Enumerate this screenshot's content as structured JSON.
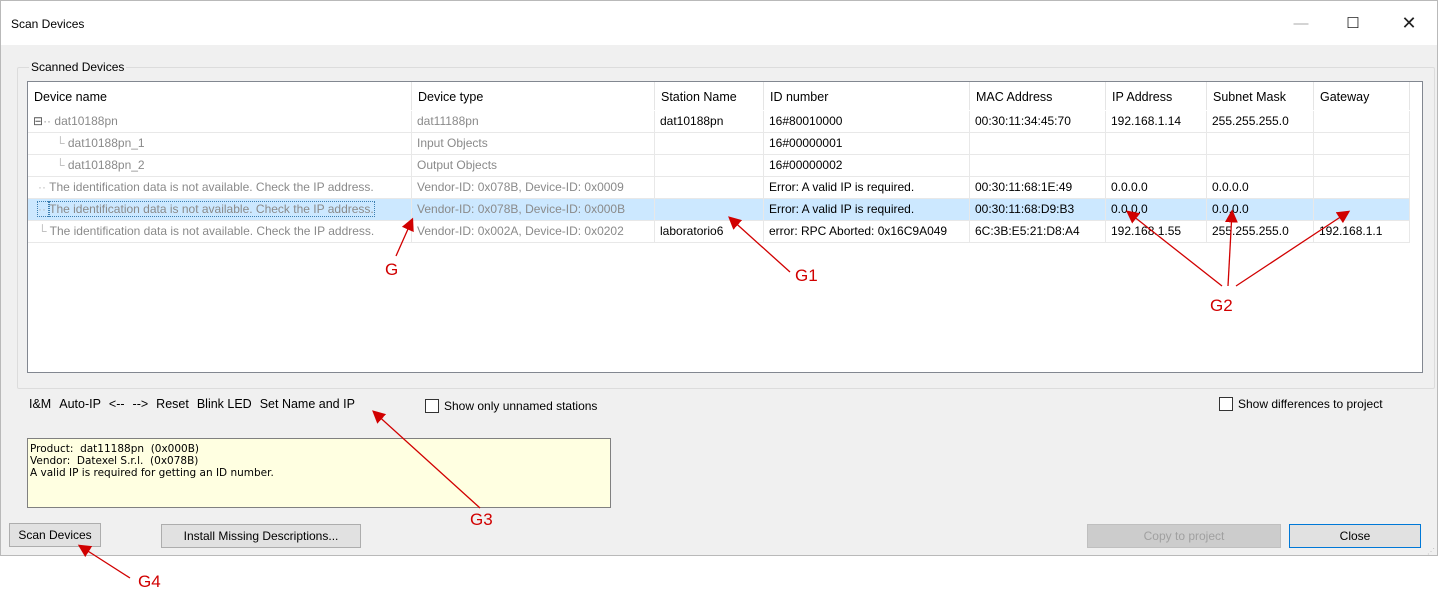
{
  "window": {
    "title": "Scan Devices",
    "min_glyph": "—",
    "max_glyph": "☐",
    "close_glyph": "✕"
  },
  "group": {
    "label": "Scanned Devices"
  },
  "table": {
    "columns": [
      "Device name",
      "Device type",
      "Station Name",
      "ID number",
      "MAC Address",
      "IP Address",
      "Subnet Mask",
      "Gateway"
    ],
    "rows": [
      {
        "name": "dat10188pn",
        "expander": "⊟",
        "type": "dat11188pn",
        "station": "dat10188pn",
        "id": "16#80010000",
        "mac": "00:30:11:34:45:70",
        "ip": "192.168.1.14",
        "mask": "255.255.255.0",
        "gw": ""
      },
      {
        "name": "dat10188pn_1",
        "type": "Input Objects",
        "station": "",
        "id": "16#00000001",
        "mac": "",
        "ip": "",
        "mask": "",
        "gw": ""
      },
      {
        "name": "dat10188pn_2",
        "type": "Output Objects",
        "station": "",
        "id": "16#00000002",
        "mac": "",
        "ip": "",
        "mask": "",
        "gw": ""
      },
      {
        "name": "The identification data is not available. Check the IP address.",
        "type": "Vendor-ID: 0x078B, Device-ID: 0x0009",
        "station": "",
        "id": "Error: A valid IP is required.",
        "mac": "00:30:11:68:1E:49",
        "ip": "0.0.0.0",
        "mask": "0.0.0.0",
        "gw": ""
      },
      {
        "name": "The identification data is not available. Check the IP address.",
        "type": "Vendor-ID: 0x078B, Device-ID: 0x000B",
        "station": "",
        "id": "Error: A valid IP is required.",
        "mac": "00:30:11:68:D9:B3",
        "ip": "0.0.0.0",
        "mask": "0.0.0.0",
        "gw": ""
      },
      {
        "name": "The identification data is not available. Check the IP address.",
        "type": "Vendor-ID: 0x002A, Device-ID: 0x0202",
        "station": "laboratorio6",
        "id": "error: RPC Aborted: 0x16C9A049",
        "mac": "6C:3B:E5:21:D8:A4",
        "ip": "192.168.1.55",
        "mask": "255.255.255.0",
        "gw": "192.168.1.1"
      }
    ]
  },
  "toolbar": {
    "im": "I&M",
    "autoip": "Auto-IP",
    "prev": "<--",
    "next": "-->",
    "reset": "Reset",
    "blink": "Blink LED",
    "setname": "Set Name and IP"
  },
  "checkboxes": {
    "unnamed": "Show only unnamed stations",
    "differences": "Show differences to project"
  },
  "info_text": "Product:  dat11188pn  (0x000B)\nVendor:  Datexel S.r.l.  (0x078B)\nA valid IP is required for getting an ID number.",
  "buttons": {
    "scan": "Scan Devices",
    "install": "Install Missing Descriptions...",
    "copy": "Copy to project",
    "close": "Close"
  },
  "annotations": {
    "g": "G",
    "g1": "G1",
    "g2": "G2",
    "g3": "G3",
    "g4": "G4"
  },
  "colors": {
    "annotation": "#d10000",
    "selection": "#cce8ff",
    "info_bg": "#ffffe1"
  }
}
